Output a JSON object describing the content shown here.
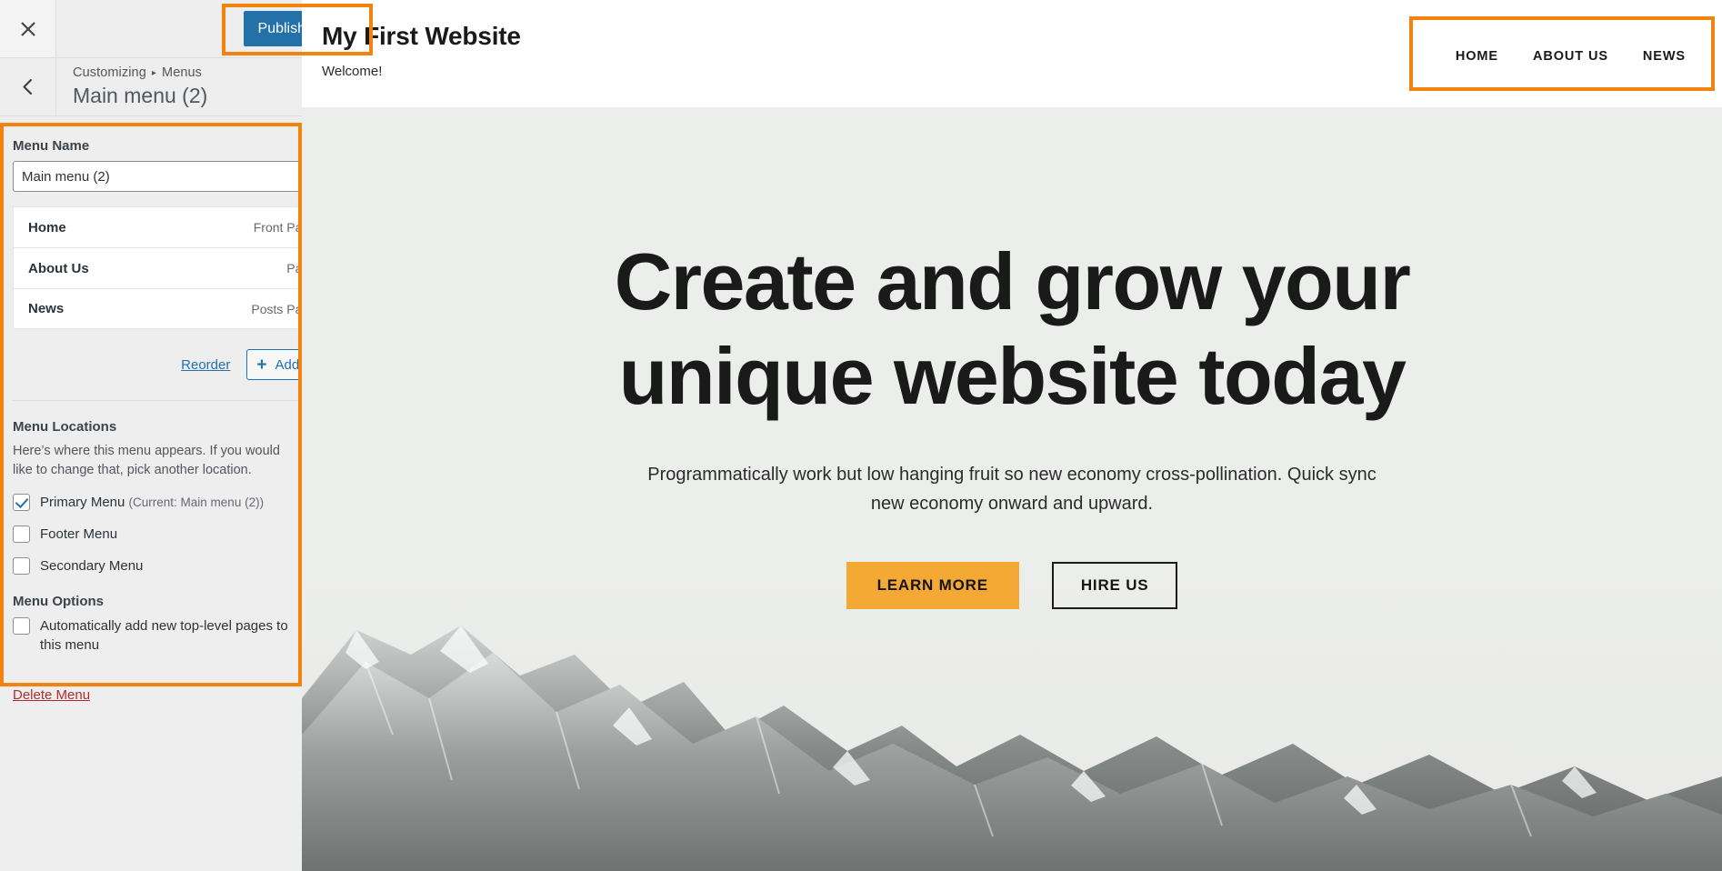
{
  "customizer": {
    "close_icon": "close-icon",
    "publish_label": "Publish",
    "publish_gear_icon": "gear-icon",
    "back_icon": "chevron-left-icon",
    "breadcrumb": {
      "root": "Customizing",
      "separator": "▸",
      "section": "Menus"
    },
    "panel_title": "Main menu (2)",
    "menu_name": {
      "label": "Menu Name",
      "value": "Main menu (2)",
      "placeholder": "Menu Name"
    },
    "menu_items": [
      {
        "title": "Home",
        "type": "Front Page",
        "caret": "caret-down-icon"
      },
      {
        "title": "About Us",
        "type": "Page",
        "caret": "caret-down-icon"
      },
      {
        "title": "News",
        "type": "Posts Page",
        "caret": "caret-down-icon"
      }
    ],
    "actions": {
      "reorder_label": "Reorder",
      "add_items_label": "Add Items",
      "add_items_icon": "plus-icon"
    },
    "menu_locations": {
      "title": "Menu Locations",
      "description": "Here’s where this menu appears. If you would like to change that, pick another location.",
      "checkboxes": [
        {
          "label": "Primary Menu",
          "note": "(Current: Main menu (2))",
          "checked": true
        },
        {
          "label": "Footer Menu",
          "note": "",
          "checked": false
        },
        {
          "label": "Secondary Menu",
          "note": "",
          "checked": false
        }
      ]
    },
    "menu_options": {
      "title": "Menu Options",
      "checkboxes": [
        {
          "label": "Automatically add new top-level pages to this menu",
          "note": "",
          "checked": false
        }
      ]
    },
    "delete_label": "Delete Menu"
  },
  "preview": {
    "site_title": "My First Website",
    "site_tagline": "Welcome!",
    "nav": [
      {
        "label": "HOME"
      },
      {
        "label": "ABOUT US"
      },
      {
        "label": "NEWS"
      }
    ],
    "hero": {
      "title": "Create and grow your unique website today",
      "subtitle": "Programmatically work but low hanging fruit so new economy cross-pollination. Quick sync new economy onward and upward.",
      "primary_button": "LEARN MORE",
      "secondary_button": "HIRE US"
    }
  },
  "colors": {
    "publish_blue": "#2371a8",
    "highlight_orange": "#f3830f",
    "link_blue": "#2271b1",
    "delete_red": "#b32d2e",
    "hero_button_orange": "#f5a935"
  }
}
